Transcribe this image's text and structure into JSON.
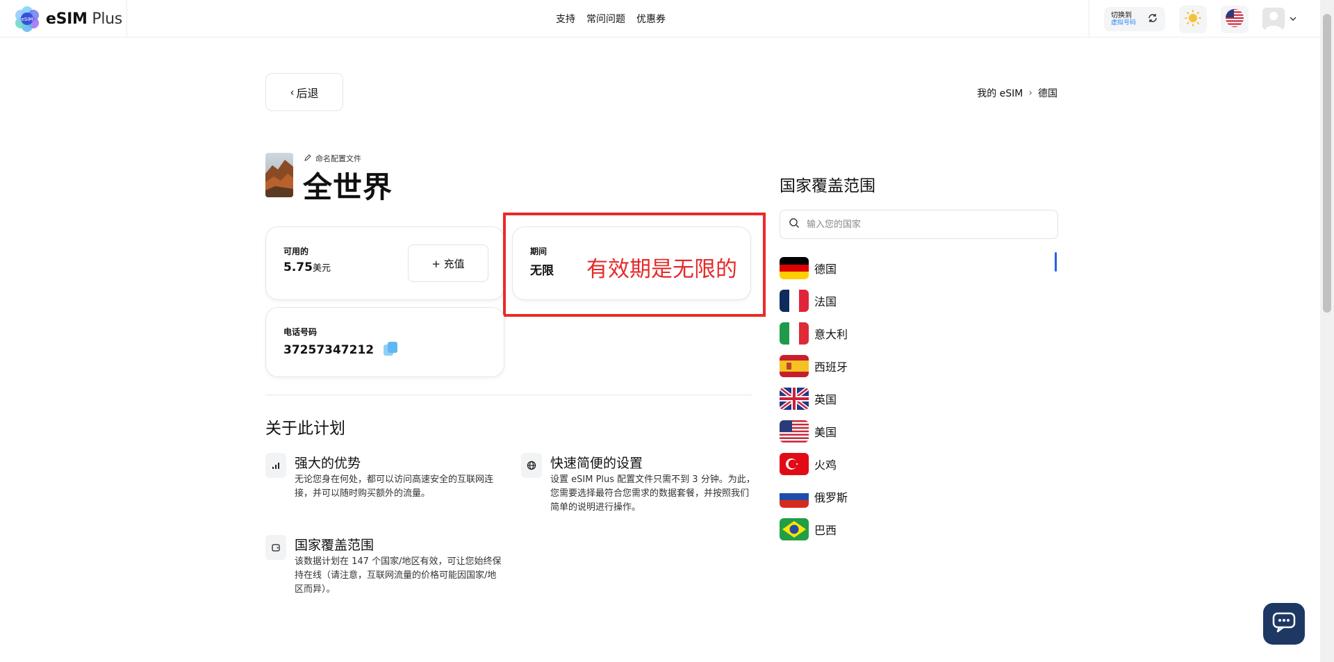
{
  "header": {
    "logo_text_bold": "eSIM",
    "logo_text_light": " Plus",
    "logo_badge": "eSIM",
    "nav": [
      "支持",
      "常问问题",
      "优惠券"
    ],
    "switch_line1": "切换到",
    "switch_line2": "虚拟号码",
    "icons": [
      "sun-icon",
      "us-flag-icon",
      "avatar-icon",
      "chevron-down-icon"
    ]
  },
  "back_label": "后退",
  "breadcrumb": [
    "我的 eSIM",
    "德国"
  ],
  "profile": {
    "rename_label": "命名配置文件",
    "title": "全世界"
  },
  "balance_card": {
    "label": "可用的",
    "value": "5.75",
    "unit": "美元",
    "topup_label": "+ 充值"
  },
  "period_card": {
    "label": "期间",
    "value": "无限"
  },
  "annotation": "有效期是无限的",
  "phone_card": {
    "label": "电话号码",
    "value": "37257347212"
  },
  "about": {
    "title": "关于此计划",
    "features": [
      {
        "title": "强大的优势",
        "desc": "无论您身在何处，都可以访问高速安全的互联网连接，并可以随时购买额外的流量。"
      },
      {
        "title": "快速简便的设置",
        "desc": "设置 eSIM Plus 配置文件只需不到 3 分钟。为此，您需要选择最符合您需求的数据套餐，并按照我们简单的说明进行操作。"
      },
      {
        "title": "国家覆盖范围",
        "desc": "该数据计划在 147 个国家/地区有效，可让您始终保持在线（请注意，互联网流量的价格可能因国家/地区而异）。"
      }
    ]
  },
  "coverage": {
    "title": "国家覆盖范围",
    "search_placeholder": "输入您的国家",
    "countries": [
      "德国",
      "法国",
      "意大利",
      "西班牙",
      "英国",
      "美国",
      "火鸡",
      "俄罗斯",
      "巴西"
    ]
  },
  "colors": {
    "accent": "#2a5de8",
    "annotation_red": "#ea2a2a",
    "chat_button": "#1e3864"
  }
}
